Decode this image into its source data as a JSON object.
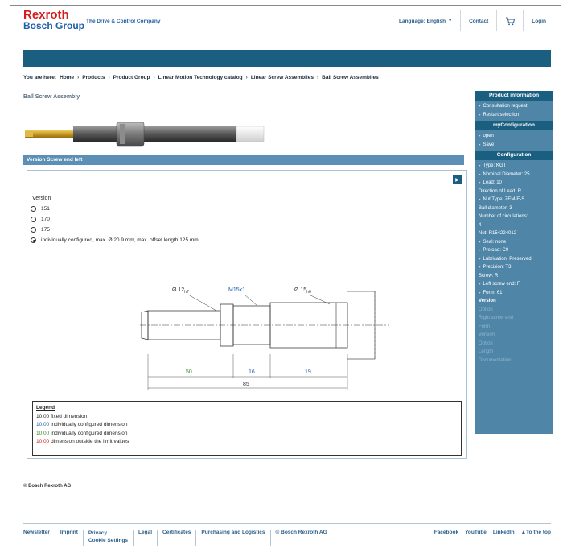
{
  "header": {
    "logo_line1": "Rexroth",
    "logo_line2": "Bosch Group",
    "tagline": "The Drive & Control Company",
    "nav": {
      "language": "Language: English",
      "contact": "Contact",
      "login": "Login"
    }
  },
  "breadcrumb": {
    "prefix": "You are here:",
    "items": [
      "Home",
      "Products",
      "Product Group",
      "Linear Motion Technology catalog",
      "Linear Screw Assemblies",
      "Ball Screw Assemblies"
    ],
    "sep": "›"
  },
  "page": {
    "title": "Ball Screw Assembly",
    "version_bar": "Version Screw end left"
  },
  "config": {
    "version_label": "Version",
    "options": [
      {
        "label": "151",
        "selected": false
      },
      {
        "label": "170",
        "selected": false
      },
      {
        "label": "175",
        "selected": false
      },
      {
        "label": "individually configured, max. Ø 20.9 mm, max. offset length 125 mm",
        "selected": true
      }
    ],
    "drawing": {
      "d1": "Ø 12",
      "d1_sub": "h7",
      "d2": "M15x1",
      "d3": "Ø 15",
      "d3_sub": "h6",
      "dim_a": "50",
      "dim_b": "16",
      "dim_c": "19",
      "dim_total": "85"
    },
    "legend": {
      "title": "Legend",
      "rows": [
        {
          "num": "10.00",
          "text": "fixed dimension",
          "color": "#222222"
        },
        {
          "num": "10.00",
          "text": "individually configured dimension",
          "color": "#1f5fa8"
        },
        {
          "num": "10.00",
          "text": "individually configured dimension",
          "color": "#3a8a2a"
        },
        {
          "num": "10.00",
          "text": "dimension outside the limit values",
          "color": "#d21e1e"
        }
      ]
    }
  },
  "sidebar": {
    "product_info": {
      "title": "Product information",
      "items": [
        "Consultation request",
        "Restart selection"
      ]
    },
    "myconfig": {
      "title": "myConfiguration",
      "items": [
        "open",
        "Save"
      ]
    },
    "configuration": {
      "title": "Configuration",
      "items": [
        {
          "text": "Type: KGT",
          "arrow": true,
          "style": ""
        },
        {
          "text": "Nominal Diameter: 25",
          "arrow": true,
          "style": ""
        },
        {
          "text": "Lead: 10",
          "arrow": true,
          "style": ""
        },
        {
          "text": "Direction of Lead: R",
          "arrow": false,
          "style": ""
        },
        {
          "text": "Nut Type: ZEM-E-S",
          "arrow": true,
          "style": ""
        },
        {
          "text": "Ball diameter: 3",
          "arrow": false,
          "style": ""
        },
        {
          "text": "Number of circulations:",
          "arrow": false,
          "style": ""
        },
        {
          "text": "4",
          "arrow": false,
          "style": ""
        },
        {
          "text": "Nut: R154224012",
          "arrow": false,
          "style": ""
        },
        {
          "text": "Seal: none",
          "arrow": true,
          "style": ""
        },
        {
          "text": "Preload: C0",
          "arrow": true,
          "style": ""
        },
        {
          "text": "Lubrication: Preserved",
          "arrow": true,
          "style": ""
        },
        {
          "text": "Precision: T3",
          "arrow": true,
          "style": ""
        },
        {
          "text": "Screw: R",
          "arrow": false,
          "style": ""
        },
        {
          "text": "Left screw end: F",
          "arrow": true,
          "style": ""
        },
        {
          "text": "Form: 61",
          "arrow": true,
          "style": ""
        },
        {
          "text": "Version",
          "arrow": false,
          "style": "bold"
        },
        {
          "text": "Option",
          "arrow": false,
          "style": "dim"
        },
        {
          "text": "Right screw end",
          "arrow": false,
          "style": "dim"
        },
        {
          "text": "Form",
          "arrow": false,
          "style": "dim"
        },
        {
          "text": "Version",
          "arrow": false,
          "style": "dim"
        },
        {
          "text": "Option",
          "arrow": false,
          "style": "dim"
        },
        {
          "text": "Length",
          "arrow": false,
          "style": "dim"
        },
        {
          "text": "Documentation",
          "arrow": false,
          "style": "dim"
        }
      ]
    }
  },
  "copyright": "© Bosch Rexroth AG",
  "footer": {
    "links": [
      "Newsletter",
      "Imprint",
      "Privacy\nCookie Settings",
      "Legal",
      "Certificates",
      "Purchasing and Logistics",
      "© Bosch Rexroth AG"
    ],
    "right": [
      "Facebook",
      "YouTube",
      "LinkedIn",
      "▲To the top"
    ]
  }
}
